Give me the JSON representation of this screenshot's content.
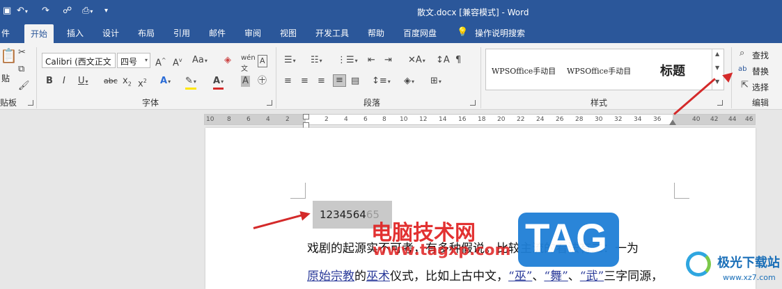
{
  "titlebar": {
    "title": "散文.docx [兼容模式] - Word"
  },
  "tabs": [
    "件",
    "开始",
    "插入",
    "设计",
    "布局",
    "引用",
    "邮件",
    "审阅",
    "视图",
    "开发工具",
    "帮助",
    "百度网盘",
    "操作说明搜索"
  ],
  "ribbon": {
    "clipboard": {
      "paste": "贴",
      "label": "贴板"
    },
    "font": {
      "name": "Calibri (西文正文",
      "size": "四号",
      "label": "字体"
    },
    "paragraph": {
      "label": "段落"
    },
    "styles": {
      "items": [
        "WPSOffice手动目",
        "WPSOffice手动目",
        "标题"
      ],
      "label": "样式"
    },
    "editing": {
      "find": "查找",
      "replace": "替换",
      "select": "选择",
      "label": "编辑"
    }
  },
  "ruler": {
    "left_numbers": [
      "10",
      "8",
      "6",
      "4",
      "2"
    ],
    "right_numbers": [
      "2",
      "4",
      "6",
      "8",
      "10",
      "12",
      "14",
      "16",
      "18",
      "20",
      "22",
      "24",
      "26",
      "28",
      "30",
      "32",
      "34",
      "36",
      "40",
      "42",
      "44",
      "46"
    ]
  },
  "document": {
    "selected_text": "1234564",
    "selected_text_tail": "65",
    "line1": "戏剧的起源实不可考，有多种假说。比较主流的看法有二：一为",
    "line2_link1": "原始宗教",
    "line2_mid1": "的",
    "line2_link2": "巫术",
    "line2_mid2": "仪式，比如上古中文，",
    "line2_q1": "“巫”",
    "line2_sep": "、",
    "line2_q2": "“舞”",
    "line2_sep2": "、",
    "line2_q3": "“武”",
    "line2_end": "三字同源，"
  },
  "watermarks": {
    "cn": "电脑技术网",
    "url": "www.tagxp.com",
    "tag": "TAG",
    "site_cn": "极光下载站",
    "site_url": "www.xz7.com"
  },
  "colors": {
    "brand": "#2b579a",
    "arrow": "#d42a2a",
    "watermark_red": "#e02020",
    "tag_blue": "#1f7fd6"
  }
}
